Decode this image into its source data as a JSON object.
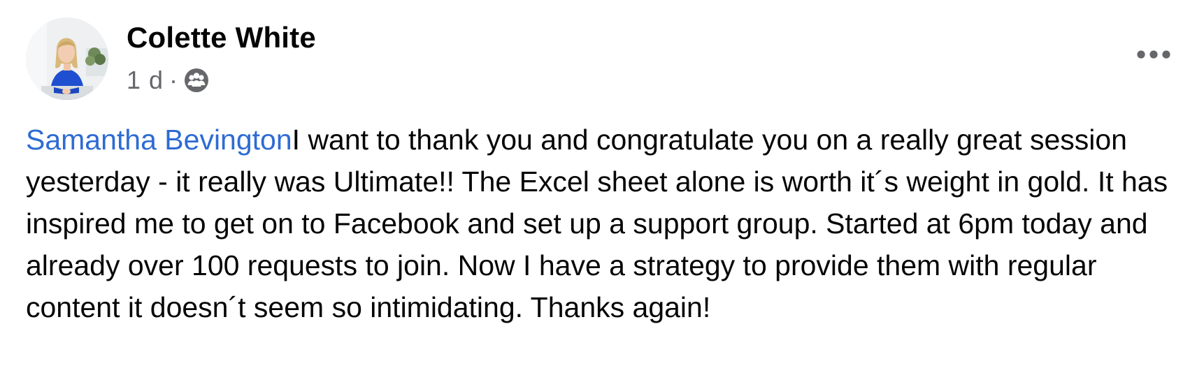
{
  "post": {
    "author": "Colette White",
    "time": "1 d",
    "separator": "·",
    "audience_icon": "group-icon",
    "more_icon": "more-options-icon",
    "mention": "Samantha Bevington",
    "text": "I want to thank you and congratulate you on a really great session yesterday - it really was Ultimate!! The Excel sheet alone is worth it´s weight in gold. It has inspired me to get on to Facebook and set up a support group. Started at 6pm today and already over 100 requests to join. Now I have a strategy to provide them with regular content it doesn´t seem so intimidating. Thanks again!"
  },
  "colors": {
    "text": "#050505",
    "secondary": "#65676b",
    "mention": "#2e6bd4",
    "avatar_shirt": "#1f4fd1"
  }
}
